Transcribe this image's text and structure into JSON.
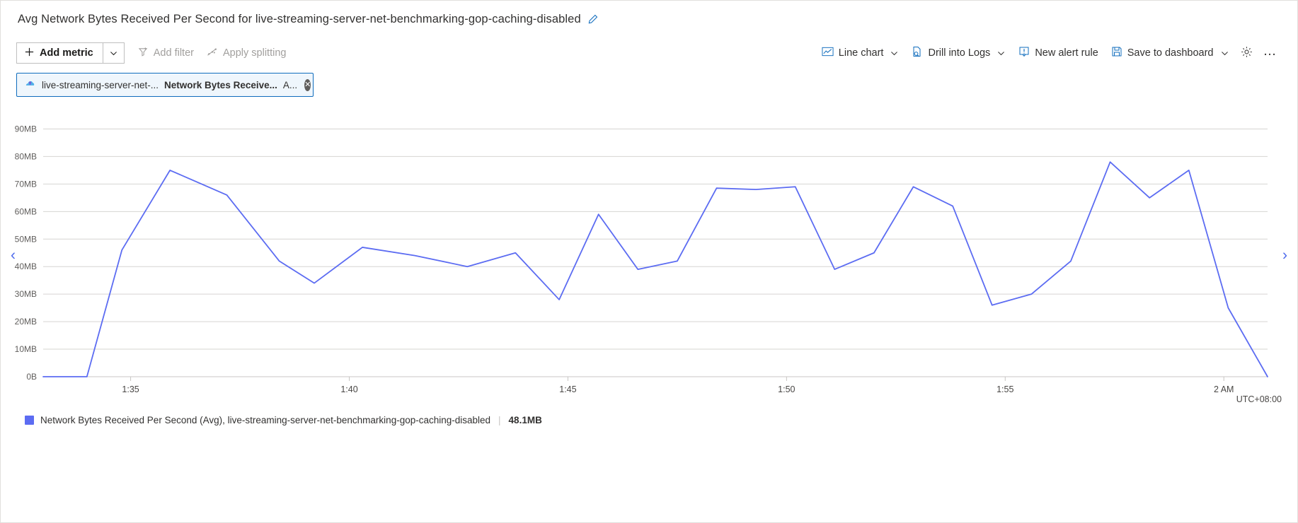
{
  "header": {
    "title": "Avg Network Bytes Received Per Second for live-streaming-server-net-benchmarking-gop-caching-disabled",
    "edit_icon": "pencil-icon"
  },
  "toolbar": {
    "add_metric_label": "Add metric",
    "add_metric_icon": "plus-icon",
    "add_metric_caret_icon": "chevron-down-icon",
    "add_filter_label": "Add filter",
    "add_filter_icon": "filter-icon",
    "apply_splitting_label": "Apply splitting",
    "apply_splitting_icon": "splitting-icon",
    "line_chart_label": "Line chart",
    "line_chart_icon": "line-chart-icon",
    "drill_into_logs_label": "Drill into Logs",
    "drill_into_logs_icon": "logs-icon",
    "new_alert_rule_label": "New alert rule",
    "new_alert_rule_icon": "alert-bell-icon",
    "save_to_dashboard_label": "Save to dashboard",
    "save_to_dashboard_icon": "save-disk-icon",
    "settings_icon": "gear-icon",
    "more_label": "…"
  },
  "metric_chip": {
    "scope_icon": "resource-icon",
    "scope": "live-streaming-server-net-...",
    "metric": "Network Bytes Receive...",
    "aggregation": "A...",
    "close_icon": "close-icon"
  },
  "navigation": {
    "prev_icon": "‹",
    "next_icon": "›"
  },
  "footer": {
    "timezone": "UTC+08:00"
  },
  "legend": {
    "swatch_color": "#5c6cf2",
    "label": "Network Bytes Received Per Second (Avg), live-streaming-server-net-benchmarking-gop-caching-disabled",
    "value": "48.1MB"
  },
  "chart_data": {
    "type": "line",
    "title": "Avg Network Bytes Received Per Second for live-streaming-server-net-benchmarking-gop-caching-disabled",
    "xlabel": "",
    "ylabel": "",
    "unit": "MB",
    "grid": true,
    "legend_position": "bottom",
    "line_color": "#5c6cf2",
    "ylim": [
      0,
      95
    ],
    "yticks": [
      0,
      10,
      20,
      30,
      40,
      50,
      60,
      70,
      80,
      90
    ],
    "ytick_labels": [
      "0B",
      "10MB",
      "20MB",
      "30MB",
      "40MB",
      "50MB",
      "60MB",
      "70MB",
      "80MB",
      "90MB"
    ],
    "xlim": [
      "1:33",
      "2:02"
    ],
    "xticks": [
      "1:35",
      "1:40",
      "1:45",
      "1:50",
      "1:55",
      "2 AM"
    ],
    "xtick_minutes": [
      95,
      100,
      105,
      110,
      115,
      120
    ],
    "series": [
      {
        "name": "Network Bytes Received Per Second (Avg), live-streaming-server-net-benchmarking-gop-caching-disabled",
        "x_minutes": [
          93.0,
          94.0,
          94.8,
          95.9,
          97.2,
          98.4,
          99.2,
          100.3,
          101.5,
          102.7,
          103.8,
          104.8,
          105.7,
          106.6,
          107.5,
          108.4,
          109.3,
          110.2,
          111.1,
          112.0,
          112.9,
          113.8,
          114.7,
          115.6,
          116.5,
          117.4,
          118.3,
          119.2,
          120.1,
          121.0
        ],
        "values": [
          0,
          0,
          46,
          75,
          66,
          42,
          34,
          47,
          44,
          40,
          45,
          28,
          59,
          39,
          42,
          68.5,
          68,
          69,
          39,
          45,
          69,
          62,
          26,
          30,
          42,
          78,
          65,
          75,
          25,
          0
        ]
      }
    ]
  }
}
